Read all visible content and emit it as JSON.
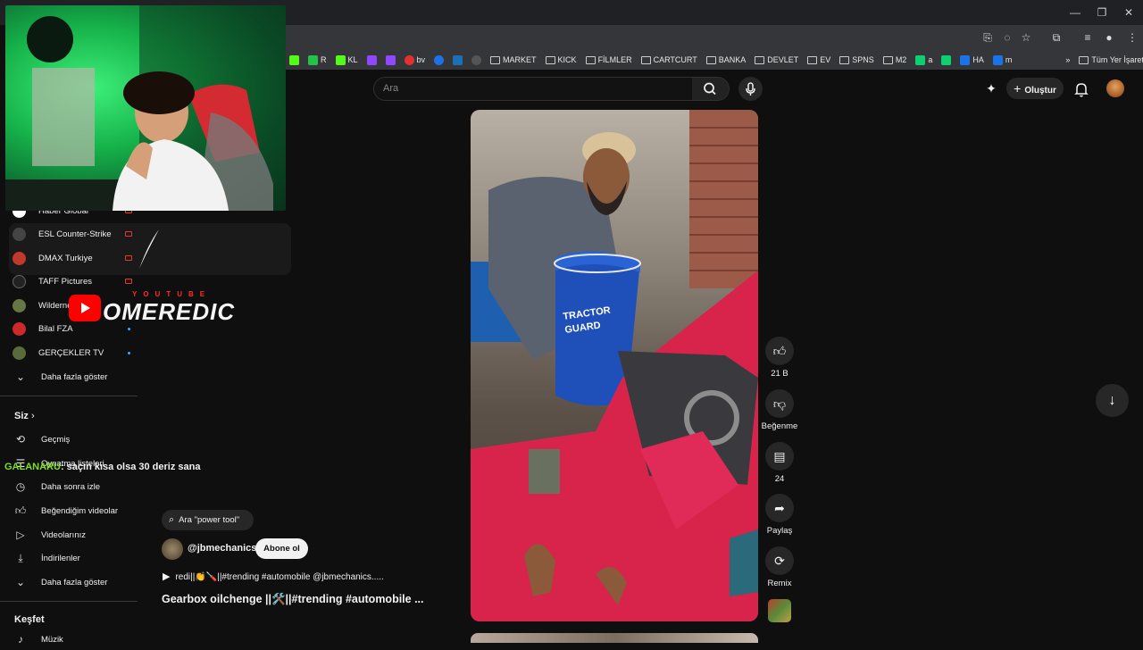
{
  "browser": {
    "bookmarks": [
      {
        "label": "R",
        "color": "#24c14a"
      },
      {
        "label": "KL",
        "color": "#53fc18"
      },
      {
        "label": "bv",
        "color": "#e3312d"
      },
      {
        "label": "a",
        "color": "#0bd26e"
      },
      {
        "label": "HA",
        "color": "#1a73e8"
      },
      {
        "label": "m",
        "color": "#1a73e8"
      }
    ],
    "folders": [
      "MARKET",
      "KICK",
      "FİLMLER",
      "CARTCURT",
      "BANKA",
      "DEVLET",
      "EV",
      "SPNS",
      "M2"
    ],
    "all_bookmarks": "Tüm Yer İşaretleri"
  },
  "header": {
    "search_placeholder": "Ara",
    "create_label": "Oluştur"
  },
  "sidebar": {
    "subscriptions": [
      {
        "label": "Haber Global",
        "color": "#ffffff",
        "indicator": "live"
      },
      {
        "label": "ESL Counter-Strike",
        "color": "#444444",
        "indicator": "live"
      },
      {
        "label": "DMAX Turkiye",
        "color": "#c0392b",
        "indicator": "live"
      },
      {
        "label": "TAFF Pictures",
        "color": "#222222",
        "indicator": "live"
      },
      {
        "label": "Wilderness",
        "color": "#667744",
        "indicator": "new"
      },
      {
        "label": "Bilal FZA",
        "color": "#cc2a2a",
        "indicator": "new"
      },
      {
        "label": "GERÇEKLER TV",
        "color": "#5a6b3a",
        "indicator": "new"
      }
    ],
    "show_more_1": "Daha fazla göster",
    "you_heading": "Siz",
    "you_items": [
      "Geçmiş",
      "Oynatma listeleri",
      "Daha sonra izle",
      "Beğendiğim videolar",
      "Videolarınız",
      "İndirilenler"
    ],
    "show_more_2": "Daha fazla göster",
    "explore_heading": "Keşfet",
    "explore_items": [
      "Müzik"
    ]
  },
  "overlay": {
    "brand_small": "YOUTUBE",
    "brand_name": "OMEREDIC",
    "chat_user": "GALANARU",
    "chat_message": ": saçın kısa olsa 30 deriz sana"
  },
  "short": {
    "search_chip": "Ara \"power tool\"",
    "channel": "@jbmechanics",
    "subscribe_label": "Abone ol",
    "music_line": "redi||👏🪛||#trending #automobile @jbmechanics.....",
    "title": "Gearbox oilchenge ||🛠️||#trending #automobile ...",
    "bucket_text_1": "TRACTOR",
    "bucket_text_2": "GUARD",
    "likes": "21 B",
    "dislike_label": "Beğenme",
    "comments": "24",
    "share_label": "Paylaş",
    "remix_label": "Remix"
  },
  "colors": {
    "background": "#0f0f0f",
    "accent_red": "#ff0000",
    "link_blue": "#3ea6ff",
    "chat_user": "#7ee021"
  }
}
